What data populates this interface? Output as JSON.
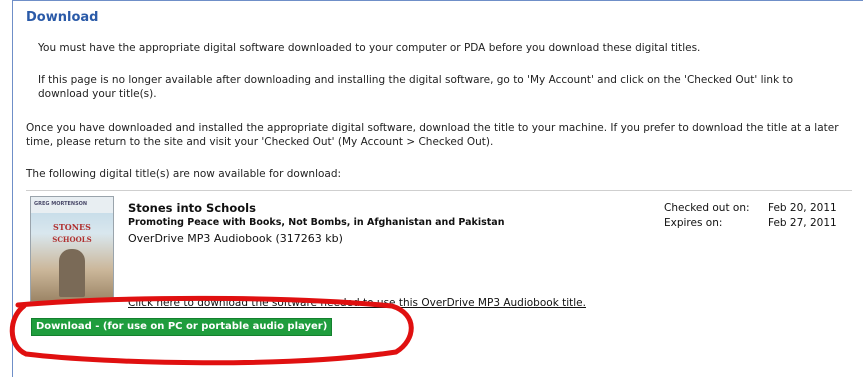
{
  "header": {
    "title": "Download"
  },
  "intro": {
    "line1": "You must have the appropriate digital software downloaded to your computer or PDA before you download these digital titles.",
    "line2": "If this page is no longer available after downloading and installing the digital software, go to 'My Account' and click on the 'Checked Out' link to download your title(s).",
    "line3": "Once you have downloaded and installed the appropriate digital software, download the title to your machine. If you prefer to download the title at a later time, please return to the site and visit your 'Checked Out' (My Account > Checked Out).",
    "line4": "The following digital title(s) are now available for download:"
  },
  "book": {
    "title": "Stones into Schools",
    "subtitle": "Promoting Peace with Books, Not Bombs, in Afghanistan and Pakistan",
    "format": "OverDrive MP3 Audiobook (317263 kb)",
    "cover": {
      "author": "GREG MORTENSON",
      "title_line1": "STONES",
      "title_line2": "SCHOOLS"
    }
  },
  "dates": {
    "checked_out_label": "Checked out on:",
    "checked_out_value": "Feb 20, 2011",
    "expires_label": "Expires on:",
    "expires_value": "Feb 27, 2011"
  },
  "help_link": "Click here to download the software needed to use this OverDrive MP3 Audiobook title.",
  "download_button": "Download - (for use on PC or portable audio player)",
  "colors": {
    "accent": "#2a5aa8",
    "download_green": "#1f9d3d",
    "annotation_red": "#e01010"
  }
}
